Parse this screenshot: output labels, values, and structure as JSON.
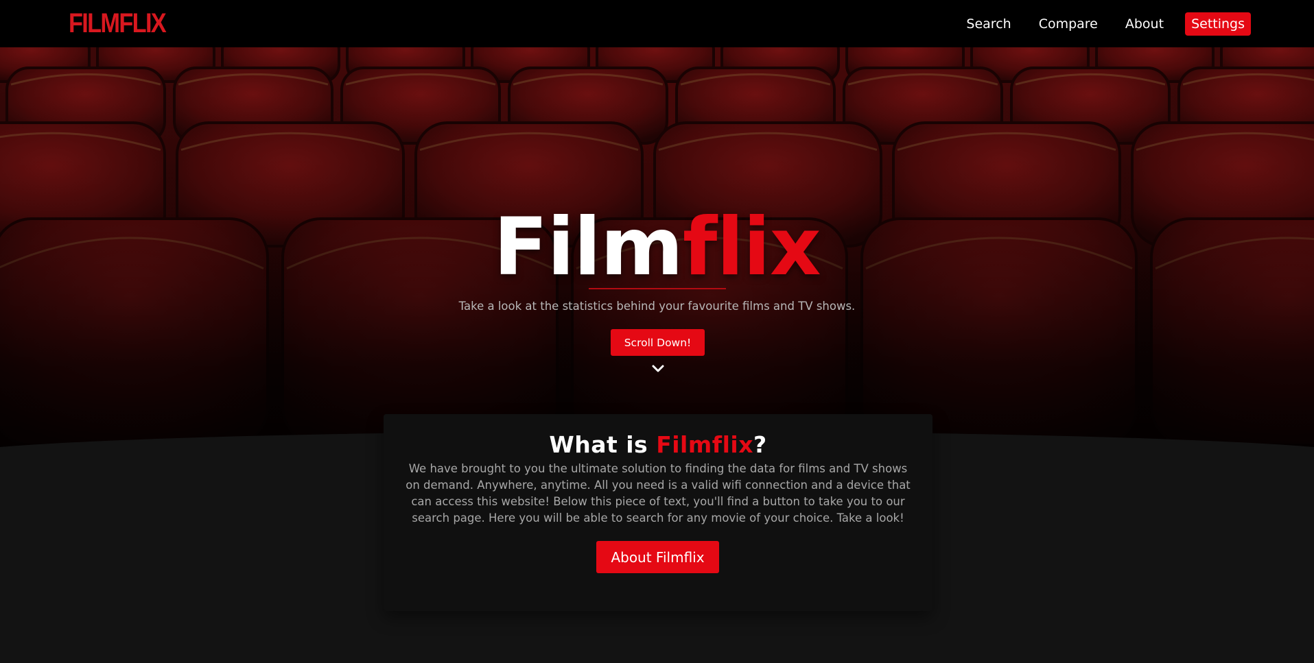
{
  "nav": {
    "logo": "FILMFLIX",
    "links": [
      {
        "label": "Search"
      },
      {
        "label": "Compare"
      },
      {
        "label": "About"
      },
      {
        "label": "Settings",
        "active": true
      }
    ]
  },
  "hero": {
    "title_white": "Film",
    "title_red": "flix",
    "tagline": "Take a look at the statistics behind your favourite films and TV shows.",
    "scroll_button": "Scroll Down!",
    "scroll_icon": "chevron-down-icon",
    "background_image": "cinema-seats"
  },
  "about": {
    "title_prefix": "What is ",
    "title_brand": "Filmflix",
    "title_suffix": "?",
    "body": "We have brought to you the ultimate solution to finding the data for films and TV shows on demand. Anywhere, anytime. All you need is a valid wifi connection and a device that can access this website! Below this piece of text, you'll find a button to take you to our search page. Here you will be able to search for any movie of your choice. Take a look!",
    "button": "About Filmflix"
  },
  "colors": {
    "accent": "#e50914",
    "logo": "#d8181f",
    "navbar": "#000000",
    "page_background": "#131313",
    "card_background": "#101010"
  }
}
